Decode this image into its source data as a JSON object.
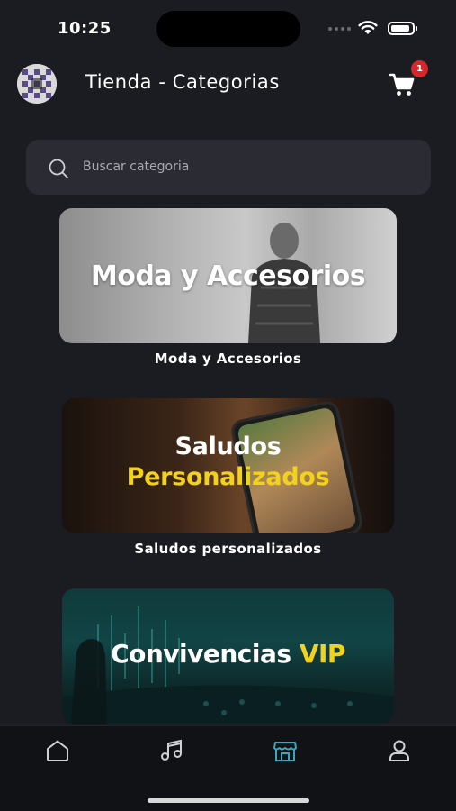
{
  "status_bar": {
    "time": "10:25",
    "battery_level": 0.92
  },
  "header": {
    "title": "Tienda - Categorias",
    "cart_icon": "cart-icon",
    "cart_badge": "1"
  },
  "search": {
    "icon": "search-icon",
    "placeholder": "Buscar categoria"
  },
  "categories": [
    {
      "headline": "Moda y Accesorios",
      "caption": "Moda y Accesorios"
    },
    {
      "headline_line1": "Saludos",
      "headline_line2": "Personalizados",
      "caption": "Saludos personalizados"
    },
    {
      "headline": "Convivencias",
      "headline_accent": "VIP"
    }
  ],
  "tab_bar": {
    "tabs": [
      {
        "icon": "home-icon",
        "active": false
      },
      {
        "icon": "music-icon",
        "active": false
      },
      {
        "icon": "store-icon",
        "active": true
      },
      {
        "icon": "profile-icon",
        "active": false
      }
    ]
  },
  "colors": {
    "background": "#1b1c21",
    "accent": "#3aa7bd",
    "highlight_yellow": "#f2d21b",
    "badge": "#d8262a"
  }
}
